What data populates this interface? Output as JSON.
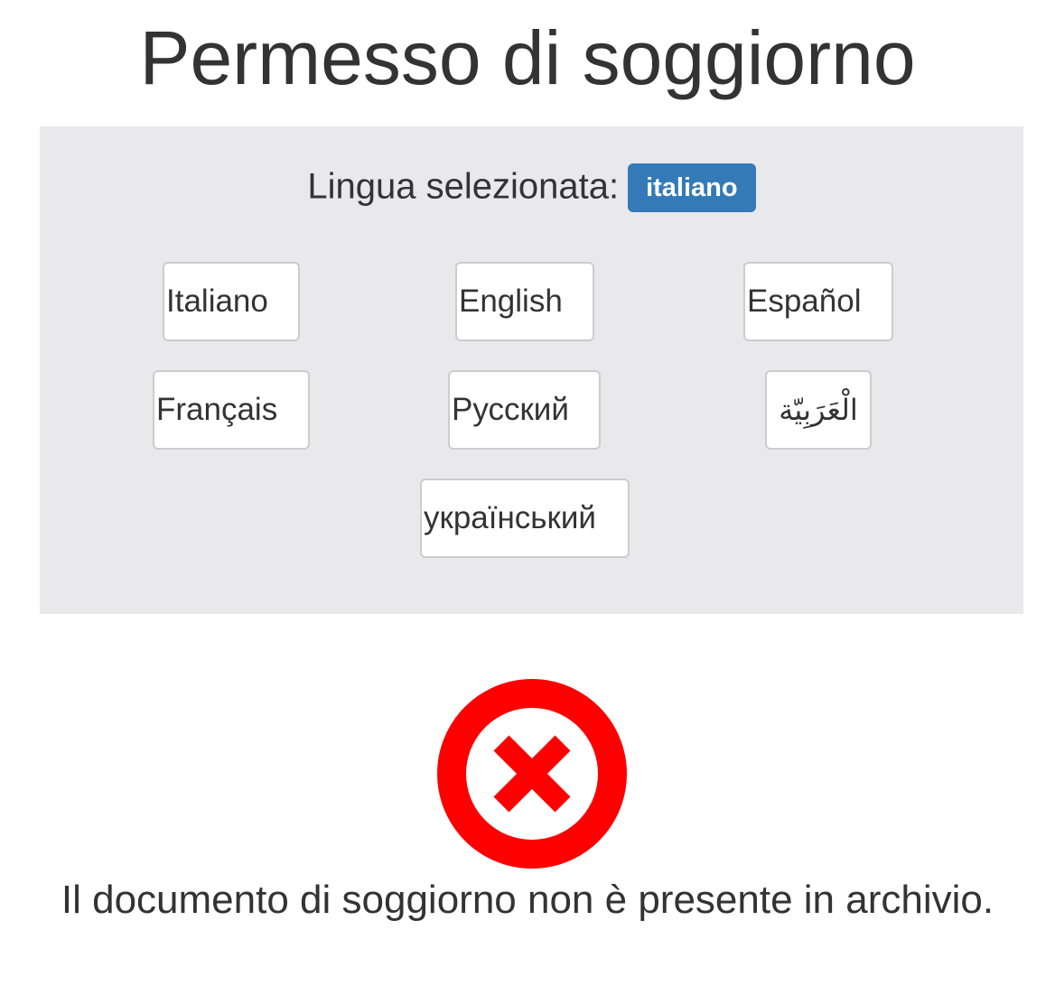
{
  "header": {
    "title": "Permesso di soggiorno"
  },
  "language_panel": {
    "selected_label": "Lingua selezionata:",
    "selected_value": "italiano",
    "badge_color": "#337ab7",
    "panel_color": "#e9e9eb",
    "options": [
      {
        "label": "Italiano"
      },
      {
        "label": "English"
      },
      {
        "label": "Español"
      },
      {
        "label": "Français"
      },
      {
        "label": "Русский"
      },
      {
        "label": "الْعَرَبِيّة"
      },
      {
        "label": "український"
      }
    ]
  },
  "result": {
    "icon": "error-circle-x-icon",
    "icon_color": "#ff0000",
    "message": "Il documento di soggiorno non è presente in archivio."
  }
}
